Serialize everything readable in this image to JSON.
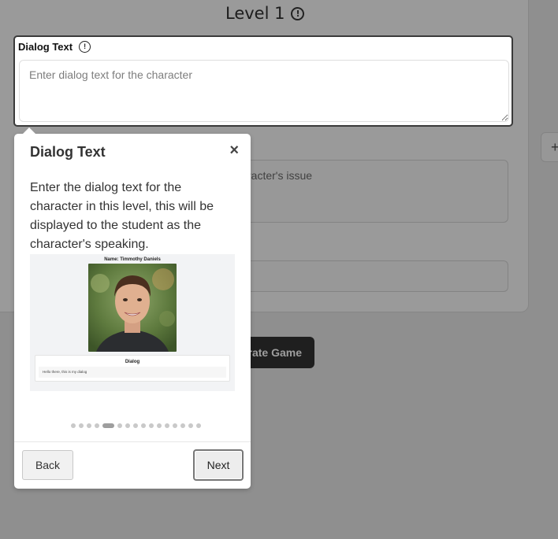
{
  "level": {
    "title": "Level 1",
    "info_icon": "info-circle-icon"
  },
  "dialog_field": {
    "label": "Dialog Text",
    "info_icon": "info-circle-icon",
    "placeholder": "Enter dialog text for the character"
  },
  "background": {
    "issue_placeholder_fragment": "racter's issue",
    "plus_button": "+",
    "generate_button": "rate Game"
  },
  "popover": {
    "title": "Dialog Text",
    "close_icon": "close-icon",
    "close_glyph": "×",
    "description": "Enter the dialog text for the character in this level, this will be displayed to the student as the character's speaking.",
    "preview": {
      "name_label": "Name: Timmothy Daniels",
      "dialog_title": "Dialog",
      "dialog_text": "Hello there, this is my dialog"
    },
    "steps": {
      "total": 16,
      "current": 5
    },
    "back_label": "Back",
    "next_label": "Next"
  },
  "colors": {
    "accent": "#1f1f1f",
    "overlay": "#8f8f8f"
  }
}
